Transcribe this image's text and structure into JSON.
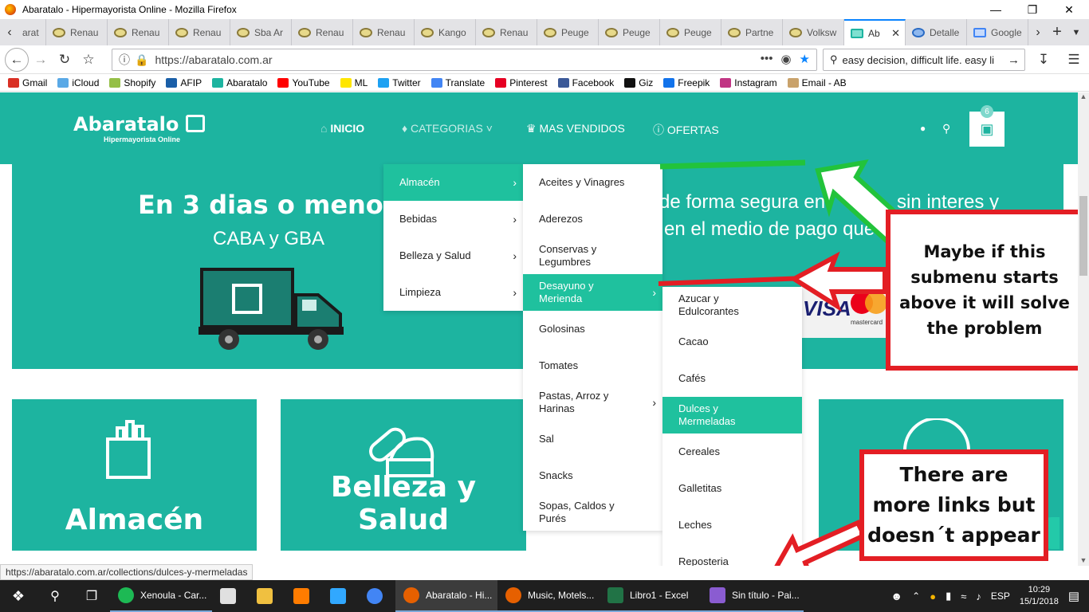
{
  "browser": {
    "window_title": "Abaratalo - Hipermayorista Online - Mozilla Firefox",
    "tabs": [
      {
        "label": "arat"
      },
      {
        "label": "Renau"
      },
      {
        "label": "Renau"
      },
      {
        "label": "Renau"
      },
      {
        "label": "Sba Ar"
      },
      {
        "label": "Renau"
      },
      {
        "label": "Renau"
      },
      {
        "label": "Kango"
      },
      {
        "label": "Renau"
      },
      {
        "label": "Peuge"
      },
      {
        "label": "Peuge"
      },
      {
        "label": "Peuge"
      },
      {
        "label": "Partne"
      },
      {
        "label": "Volksw"
      },
      {
        "label": "Ab"
      },
      {
        "label": "Detalle"
      },
      {
        "label": "Google"
      }
    ],
    "url": "https://abaratalo.com.ar",
    "search_text": "easy decision, difficult life. easy li",
    "bookmarks": [
      {
        "label": "Gmail",
        "color": "#d93025"
      },
      {
        "label": "iCloud",
        "color": "#5aa9e6"
      },
      {
        "label": "Shopify",
        "color": "#95bf47"
      },
      {
        "label": "AFIP",
        "color": "#1a5fa8"
      },
      {
        "label": "Abaratalo",
        "color": "#1db4a0"
      },
      {
        "label": "YouTube",
        "color": "#ff0000"
      },
      {
        "label": "ML",
        "color": "#ffe600"
      },
      {
        "label": "Twitter",
        "color": "#1da1f2"
      },
      {
        "label": "Translate",
        "color": "#4285f4"
      },
      {
        "label": "Pinterest",
        "color": "#e60023"
      },
      {
        "label": "Facebook",
        "color": "#3b5998"
      },
      {
        "label": "Giz",
        "color": "#111111"
      },
      {
        "label": "Freepik",
        "color": "#1273eb"
      },
      {
        "label": "Instagram",
        "color": "#c13584"
      },
      {
        "label": "Email - AB",
        "color": "#c9a26b"
      }
    ],
    "status_url": "https://abaratalo.com.ar/collections/dulces-y-mermeladas"
  },
  "site": {
    "brand_color": "#1db4a0",
    "highlight_color": "#1fc19e",
    "logo": {
      "name": "Abaratalo",
      "tagline": "Hipermayorista Online"
    },
    "menu": {
      "inicio": "INICIO",
      "categorias": "CATEGORIAS",
      "mas_vendidos": "MAS VENDIDOS",
      "ofertas": "OFERTAS"
    },
    "cart_count": "6",
    "banner": {
      "headline": "En 3 dias o menos",
      "subline": "CABA y GBA",
      "right_line1": "de forma segura en",
      "right_line1b": "sin interes y",
      "right_line2": "en  el medio de pago que",
      "visa": "VISA",
      "mastercard": "mastercard"
    },
    "cards": [
      {
        "label": "Almacén"
      },
      {
        "label": "Belleza y Salud"
      }
    ],
    "dropdown_level1": [
      {
        "label": "Almacén"
      },
      {
        "label": "Bebidas"
      },
      {
        "label": "Belleza y Salud"
      },
      {
        "label": "Limpieza"
      }
    ],
    "dropdown_level2": [
      {
        "label": "Aceites y Vinagres"
      },
      {
        "label": "Aderezos"
      },
      {
        "label": "Conservas y Legumbres"
      },
      {
        "label": "Desayuno y Merienda"
      },
      {
        "label": "Golosinas"
      },
      {
        "label": "Tomates"
      },
      {
        "label": "Pastas, Arroz y Harinas"
      },
      {
        "label": "Sal"
      },
      {
        "label": "Snacks"
      },
      {
        "label": "Sopas, Caldos y Purés"
      }
    ],
    "dropdown_level3": [
      {
        "label": "Azucar y Edulcorantes"
      },
      {
        "label": "Cacao"
      },
      {
        "label": "Cafés"
      },
      {
        "label": "Dulces y Mermeladas"
      },
      {
        "label": "Cereales"
      },
      {
        "label": "Galletitas"
      },
      {
        "label": "Leches"
      },
      {
        "label": "Reposteria"
      }
    ]
  },
  "annotations": {
    "note1": "Maybe if this submenu starts above it will solve the problem",
    "note2": "There are more links but doesn´t appear"
  },
  "taskbar": {
    "apps": [
      {
        "label": "Xenoula - Car...",
        "color": "#1db954"
      },
      {
        "label": "",
        "color": "#e0e0e0"
      },
      {
        "label": "",
        "color": "#f0c040"
      },
      {
        "label": "",
        "color": "#ff7c00"
      },
      {
        "label": "",
        "color": "#31a8ff"
      },
      {
        "label": "",
        "color": "#4285f4"
      },
      {
        "label": "Abaratalo - Hi...",
        "color": "#e66000"
      },
      {
        "label": "Music, Motels...",
        "color": "#e66000"
      },
      {
        "label": "Libro1 - Excel",
        "color": "#217346"
      },
      {
        "label": "Sin título - Pai...",
        "color": "#8a5cd1"
      }
    ],
    "language": "ESP",
    "time": "10:29",
    "date": "15/1/2018"
  }
}
